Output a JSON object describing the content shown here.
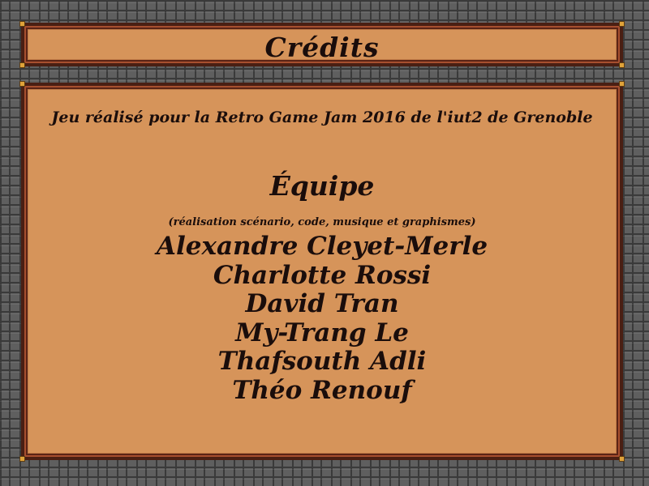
{
  "title": "Crédits",
  "subtitle": "Jeu réalisé pour la Retro Game Jam 2016 de l'iut2 de Grenoble",
  "team": {
    "heading": "Équipe",
    "role": "(réalisation scénario, code, musique et graphismes)",
    "members": [
      "Alexandre Cleyet-Merle",
      "Charlotte Rossi",
      "David Tran",
      "My-Trang Le",
      "Thafsouth Adli",
      "Théo Renouf"
    ]
  }
}
